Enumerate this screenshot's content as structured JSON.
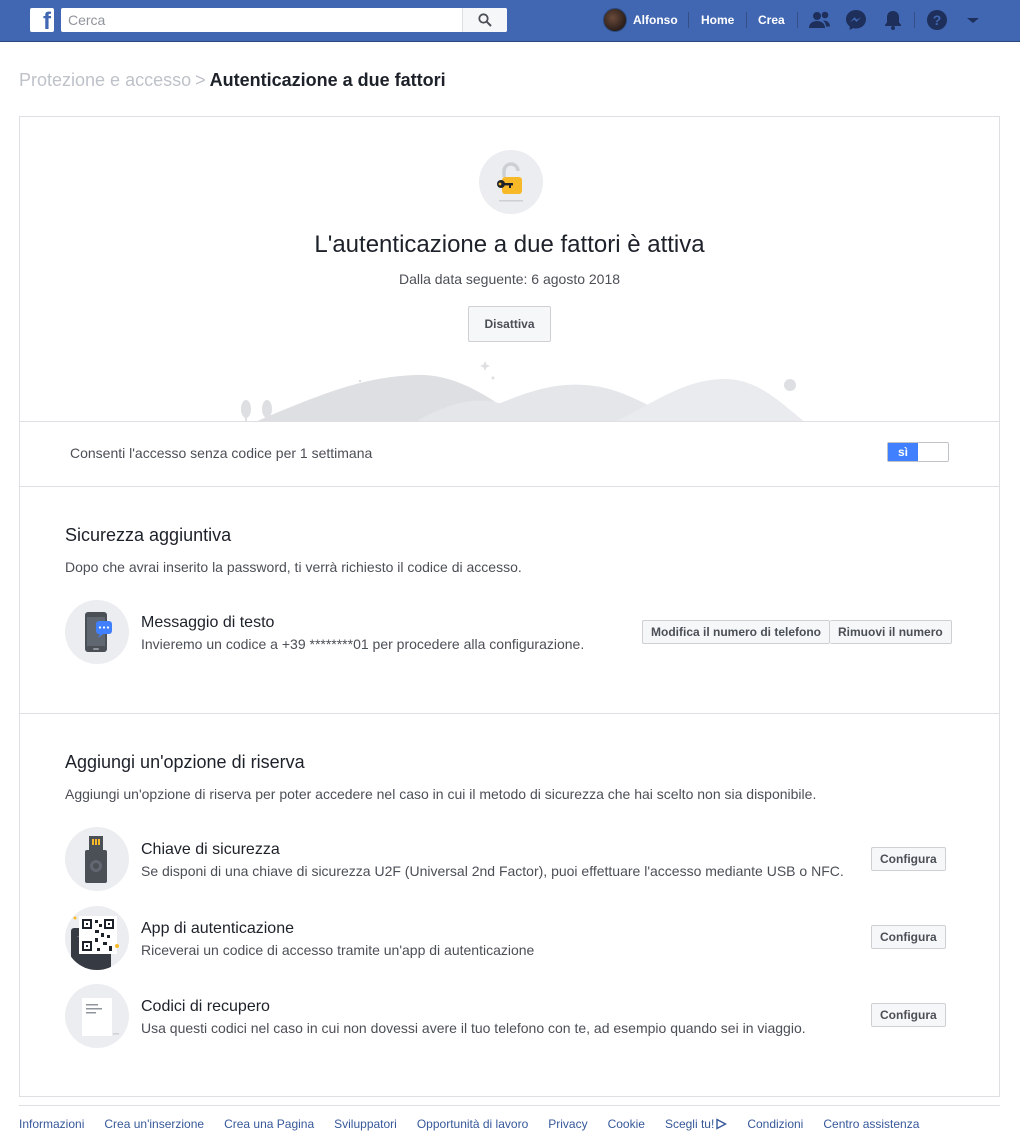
{
  "topbar": {
    "search_placeholder": "Cerca",
    "user_name": "Alfonso",
    "home_label": "Home",
    "create_label": "Crea"
  },
  "breadcrumb": {
    "parent": "Protezione e accesso",
    "separator": ">",
    "current": "Autenticazione a due fattori"
  },
  "hero": {
    "title": "L'autenticazione a due fattori è attiva",
    "since": "Dalla data seguente: 6 agosto 2018",
    "deactivate_label": "Disattiva"
  },
  "no_code_access": {
    "label": "Consenti l'accesso senza codice per 1 settimana",
    "toggle_label": "sì",
    "enabled": true
  },
  "extra_security": {
    "title": "Sicurezza aggiuntiva",
    "description": "Dopo che avrai inserito la password, ti verrà richiesto il codice di accesso.",
    "sms": {
      "title": "Messaggio di testo",
      "description": "Invieremo un codice a +39 ********01 per procedere alla configurazione.",
      "edit_label": "Modifica il numero di telefono",
      "remove_label": "Rimuovi il numero"
    }
  },
  "backup": {
    "title": "Aggiungi un'opzione di riserva",
    "description": "Aggiungi un'opzione di riserva per poter accedere nel caso in cui il metodo di sicurezza che hai scelto non sia disponibile.",
    "options": [
      {
        "title": "Chiave di sicurezza",
        "description": "Se disponi di una chiave di sicurezza U2F (Universal 2nd Factor), puoi effettuare l'accesso mediante USB o NFC.",
        "button": "Configura"
      },
      {
        "title": "App di autenticazione",
        "description": "Riceverai un codice di accesso tramite un'app di autenticazione",
        "button": "Configura"
      },
      {
        "title": "Codici di recupero",
        "description": "Usa questi codici nel caso in cui non dovessi avere il tuo telefono con te, ad esempio quando sei in viaggio.",
        "button": "Configura"
      }
    ]
  },
  "footer": {
    "links": [
      "Informazioni",
      "Crea un'inserzione",
      "Crea una Pagina",
      "Sviluppatori",
      "Opportunità di lavoro",
      "Privacy",
      "Cookie",
      "Scegli tu!",
      "Condizioni",
      "Centro assistenza"
    ]
  },
  "colors": {
    "brand": "#4267b2",
    "toggle_on": "#4080ff",
    "link": "#365899"
  },
  "icons": [
    "facebook-logo-icon",
    "search-icon",
    "friends-icon",
    "messenger-icon",
    "notifications-icon",
    "help-icon",
    "dropdown-arrow-icon",
    "unlocked-padlock-icon",
    "phone-sms-icon",
    "usb-key-icon",
    "qr-code-icon",
    "document-icon",
    "adchoices-icon"
  ]
}
